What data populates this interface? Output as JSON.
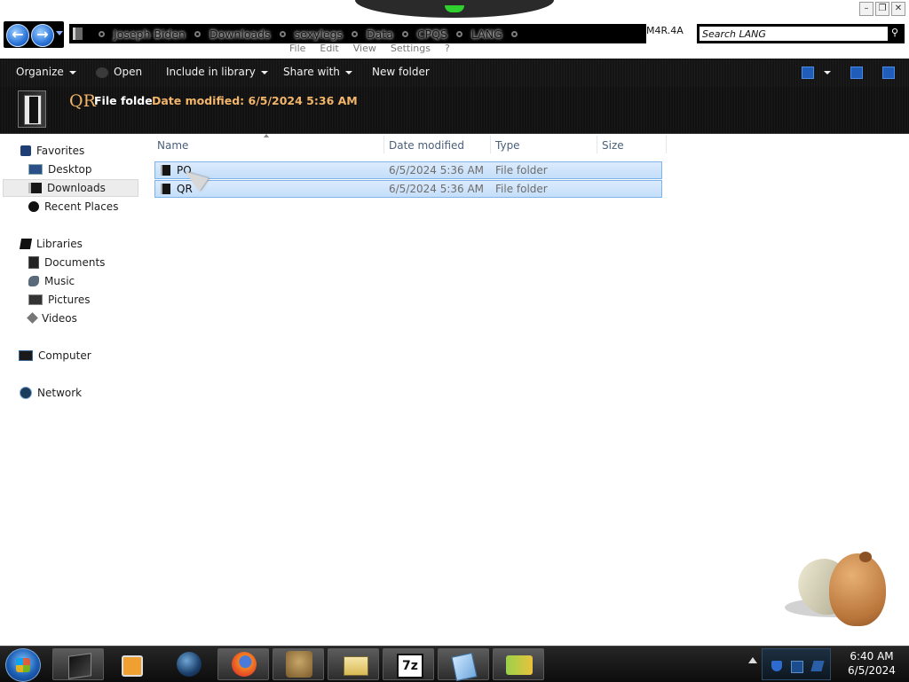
{
  "window": {
    "controls": [
      "–",
      "❐",
      "✕"
    ]
  },
  "address": {
    "crumbs": [
      "Joseph Biden",
      "Downloads",
      "sexylegs",
      "Data",
      "CPQS",
      "LANG"
    ],
    "extra": "M4R.4A"
  },
  "search": {
    "placeholder": "Search LANG"
  },
  "menubar": [
    "File",
    "Edit",
    "View",
    "Settings",
    "?"
  ],
  "commandbar": {
    "organize": "Organize",
    "open": "Open",
    "include": "Include in library",
    "share": "Share with",
    "new_folder": "New folder"
  },
  "details": {
    "name": "QR",
    "type": "File folder",
    "date_label": "Date modified: 6/5/2024 5:36 AM"
  },
  "nav": {
    "favorites": "Favorites",
    "desktop": "Desktop",
    "downloads": "Downloads",
    "recent": "Recent Places",
    "libraries": "Libraries",
    "documents": "Documents",
    "music": "Music",
    "pictures": "Pictures",
    "videos": "Videos",
    "computer": "Computer",
    "network": "Network"
  },
  "columns": {
    "name": "Name",
    "date": "Date modified",
    "type": "Type",
    "size": "Size"
  },
  "files": [
    {
      "name": "PQ",
      "date": "6/5/2024 5:36 AM",
      "type": "File folder"
    },
    {
      "name": "QR",
      "date": "6/5/2024 5:36 AM",
      "type": "File folder"
    }
  ],
  "taskbar": {
    "apps": [
      "explorer-icon",
      "media-player-icon",
      "globe-icon",
      "firefox-icon",
      "box-game-icon",
      "folder-window-icon",
      "7zip-icon",
      "notepad-icon",
      "hxd-icon"
    ],
    "seven_zip_label": "7z"
  },
  "clock": {
    "time": "6:40 AM",
    "date": "6/5/2024"
  }
}
